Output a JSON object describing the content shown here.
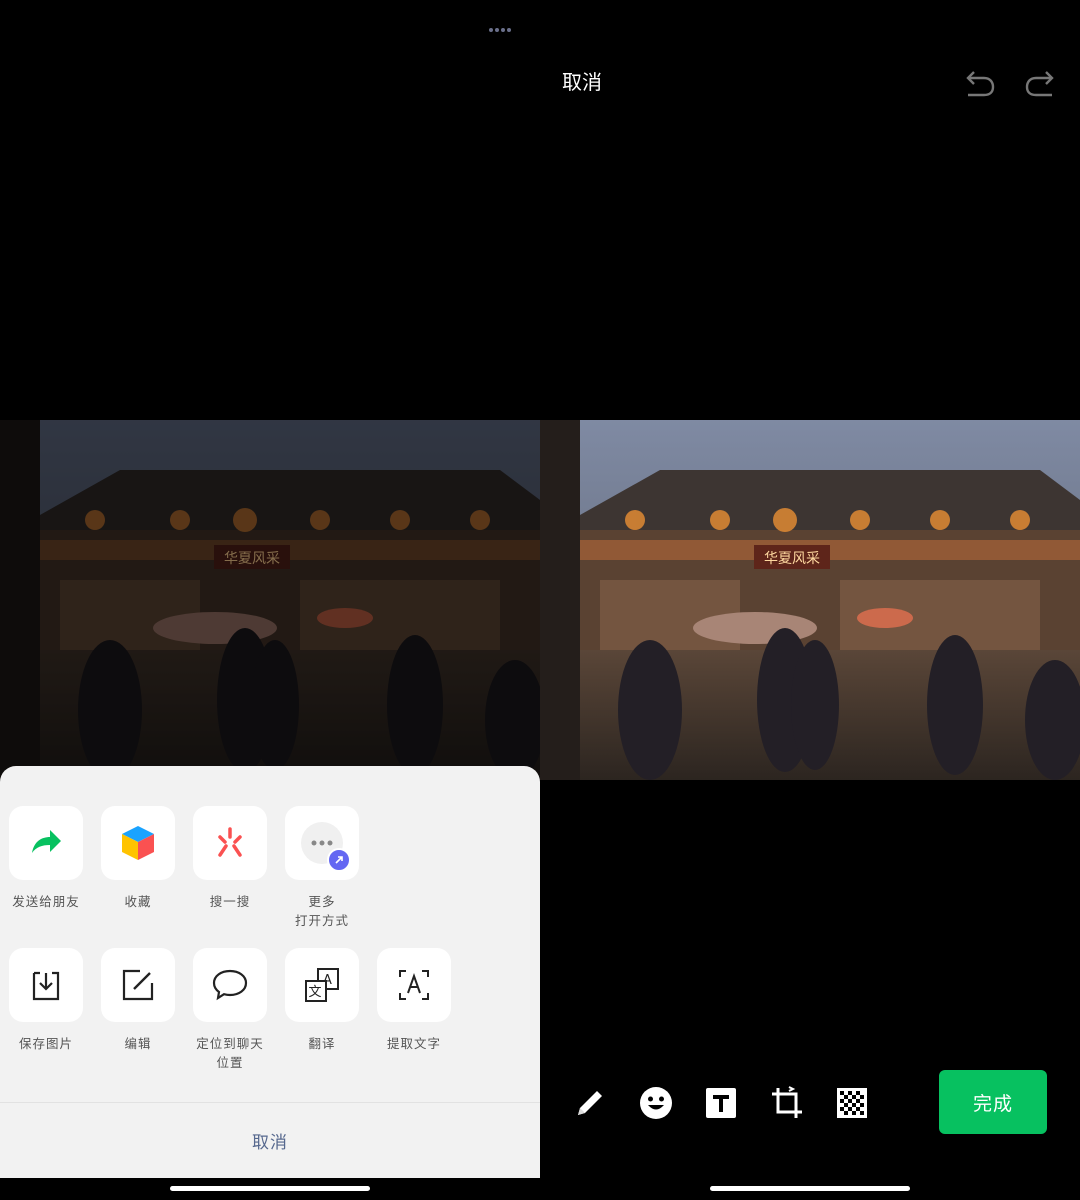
{
  "left": {
    "sheet": {
      "row1": [
        {
          "label": "发送给朋友",
          "icon": "share-arrow-icon"
        },
        {
          "label": "收藏",
          "icon": "favorite-cube-icon"
        },
        {
          "label": "搜一搜",
          "icon": "search-one-icon"
        },
        {
          "label": "更多\n打开方式",
          "icon": "more-open-icon"
        }
      ],
      "row2": [
        {
          "label": "保存图片",
          "icon": "save-image-icon"
        },
        {
          "label": "编辑",
          "icon": "edit-icon"
        },
        {
          "label": "定位到聊天\n位置",
          "icon": "chat-locate-icon"
        },
        {
          "label": "翻译",
          "icon": "translate-icon"
        },
        {
          "label": "提取文字",
          "icon": "extract-text-icon"
        }
      ],
      "cancel_label": "取消"
    }
  },
  "right": {
    "header": {
      "cancel_label": "取消"
    },
    "toolbar": {
      "tools": [
        "pencil-icon",
        "emoji-icon",
        "text-icon",
        "crop-rotate-icon",
        "mosaic-icon"
      ],
      "done_label": "完成"
    }
  },
  "photo": {
    "sign_text": "华夏风采"
  },
  "colors": {
    "accent_green": "#07c160",
    "sheet_bg": "#f2f2f2",
    "cancel_blue": "#56688e"
  }
}
